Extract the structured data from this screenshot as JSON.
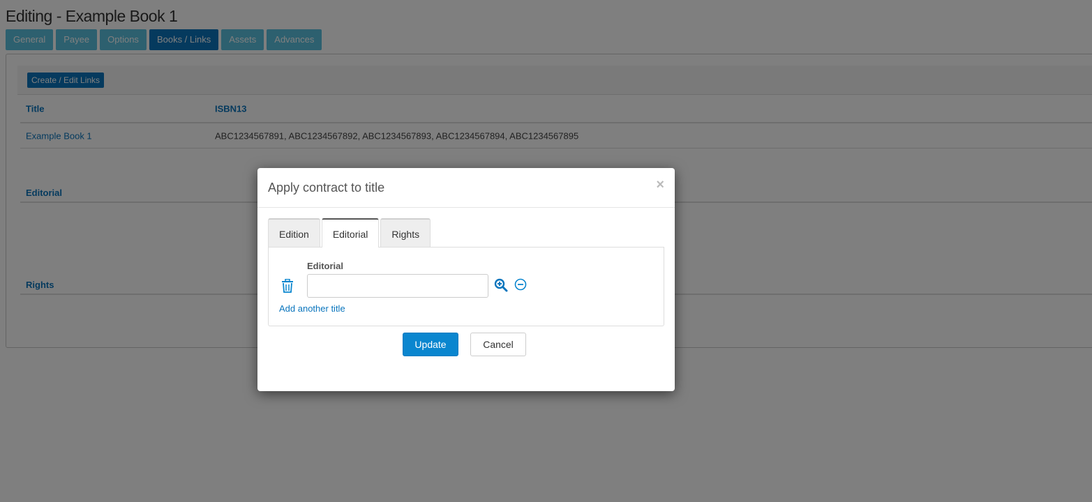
{
  "page": {
    "title": "Editing - Example Book 1",
    "tabs": [
      {
        "label": "General",
        "active": false
      },
      {
        "label": "Payee",
        "active": false
      },
      {
        "label": "Options",
        "active": false
      },
      {
        "label": "Books / Links",
        "active": true
      },
      {
        "label": "Assets",
        "active": false
      },
      {
        "label": "Advances",
        "active": false
      }
    ]
  },
  "panel": {
    "links_button": "Create / Edit Links",
    "table": {
      "headers": [
        "Title",
        "ISBN13"
      ],
      "rows": [
        [
          "Example Book 1",
          "ABC1234567891, ABC1234567892, ABC1234567893, ABC1234567894, ABC1234567895"
        ]
      ]
    },
    "sections": [
      "Editorial",
      "Rights"
    ]
  },
  "modal": {
    "title": "Apply contract to title",
    "close_glyph": "×",
    "tabs": [
      {
        "label": "Edition",
        "active": false
      },
      {
        "label": "Editorial",
        "active": true
      },
      {
        "label": "Rights",
        "active": false
      }
    ],
    "field_label": "Editorial",
    "field_value": "",
    "add_link": "Add another title",
    "update_label": "Update",
    "cancel_label": "Cancel"
  },
  "icons": {
    "delete": "trash-icon",
    "search": "zoom-in-icon",
    "remove": "minus-circle-icon"
  },
  "colors": {
    "primary": "#0a75bd",
    "tab_inactive": "#5bc0de",
    "update_button": "#0a86cf"
  }
}
